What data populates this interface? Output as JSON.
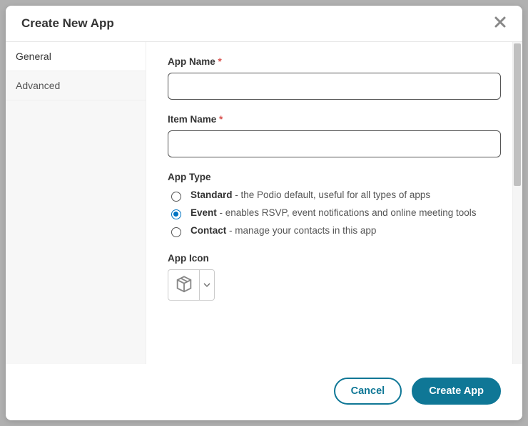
{
  "modal": {
    "title": "Create New App",
    "close_label": "×"
  },
  "sidebar": {
    "tabs": [
      {
        "label": "General",
        "active": true
      },
      {
        "label": "Advanced",
        "active": false
      }
    ]
  },
  "form": {
    "app_name_label": "App Name",
    "app_name_value": "",
    "item_name_label": "Item Name",
    "item_name_value": "",
    "app_type_label": "App Type",
    "app_type_options": [
      {
        "name": "Standard",
        "desc": "the Podio default, useful for all types of apps",
        "checked": false
      },
      {
        "name": "Event",
        "desc": "enables RSVP, event notifications and online meeting tools",
        "checked": true
      },
      {
        "name": "Contact",
        "desc": "manage your contacts in this app",
        "checked": false
      }
    ],
    "app_icon_label": "App Icon"
  },
  "footer": {
    "cancel_label": "Cancel",
    "submit_label": "Create App"
  },
  "required_marker": "*",
  "dash": " - "
}
